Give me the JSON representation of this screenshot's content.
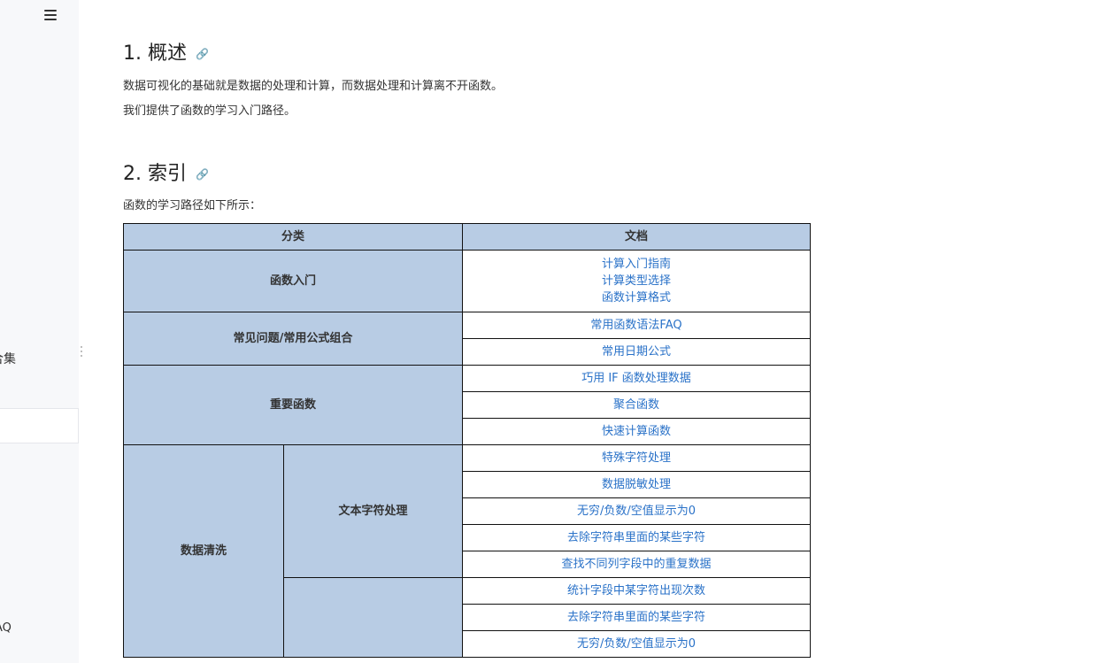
{
  "sidebar": {
    "menu_icon": "hamburger-menu-icon",
    "item1_label": "合集",
    "item2_label": "AQ"
  },
  "sections": [
    {
      "title": "1. 概述",
      "paragraphs": [
        "数据可视化的基础就是数据的处理和计算，而数据处理和计算离不开函数。",
        "我们提供了函数的学习入门路径。"
      ]
    },
    {
      "title": "2. 索引",
      "paragraphs": [
        "函数的学习路径如下所示："
      ]
    }
  ],
  "anchor_icon": "link-icon",
  "table": {
    "headers": [
      "分类",
      "文档"
    ],
    "groups": [
      {
        "category": "函数入门",
        "docs": [
          "计算入门指南",
          "计算类型选择",
          "函数计算格式"
        ]
      },
      {
        "category": "常见问题/常用公式组合",
        "docs": [
          "常用函数语法FAQ",
          "常用日期公式"
        ]
      },
      {
        "category": "重要函数",
        "docs": [
          "巧用 IF 函数处理数据",
          "聚合函数",
          "快速计算函数"
        ]
      },
      {
        "category": "数据清洗",
        "subgroups": [
          {
            "subcategory": "文本字符处理",
            "docs": [
              "特殊字符处理",
              "数据脱敏处理",
              "无穷/负数/空值显示为0",
              "去除字符串里面的某些字符",
              "查找不同列字段中的重复数据"
            ]
          },
          {
            "subcategory": "",
            "docs": [
              "统计字段中某字符出现次数",
              "去除字符串里面的某些字符",
              "无穷/负数/空值显示为0"
            ]
          }
        ]
      }
    ]
  },
  "colors": {
    "header_bg": "#b8cce4",
    "link": "#2a72c8",
    "sidebar_bg": "#f7f8fa"
  }
}
